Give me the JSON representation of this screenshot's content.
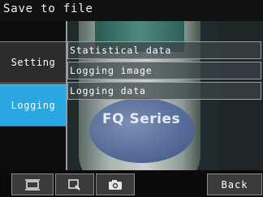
{
  "title": "Save to file",
  "tabs": [
    {
      "label": "Setting"
    },
    {
      "label": "Logging",
      "active": true
    }
  ],
  "menu": [
    {
      "label": "Statistical data"
    },
    {
      "label": "Logging image"
    },
    {
      "label": "Logging data"
    }
  ],
  "preview": {
    "overlay_text": "FQ Series"
  },
  "toolbar": {
    "buttons": [
      {
        "icon": "fit-screen-icon"
      },
      {
        "icon": "zoom-icon"
      },
      {
        "icon": "camera-icon"
      }
    ],
    "back_label": "Back"
  },
  "colors": {
    "active_tab": "#2aa6e0",
    "background": "#0c0c0c"
  }
}
